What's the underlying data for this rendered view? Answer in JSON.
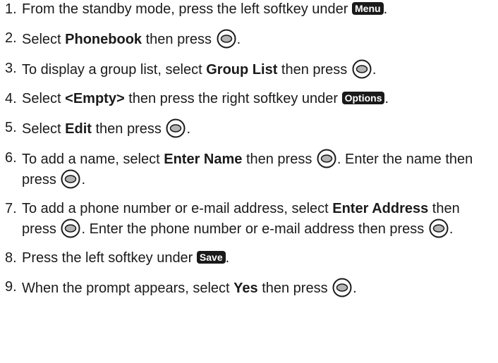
{
  "steps": [
    {
      "num": "1.",
      "parts": [
        {
          "t": "text",
          "v": "From the standby mode, press the left softkey under "
        },
        {
          "t": "key",
          "v": "Menu"
        },
        {
          "t": "text",
          "v": "."
        }
      ]
    },
    {
      "num": "2.",
      "parts": [
        {
          "t": "text",
          "v": "Select "
        },
        {
          "t": "bold",
          "v": "Phonebook"
        },
        {
          "t": "text",
          "v": " then press "
        },
        {
          "t": "icon",
          "v": "ok-button-icon"
        },
        {
          "t": "text",
          "v": "."
        }
      ]
    },
    {
      "num": "3.",
      "parts": [
        {
          "t": "text",
          "v": "To display a group list, select "
        },
        {
          "t": "bold",
          "v": "Group List"
        },
        {
          "t": "text",
          "v": " then press "
        },
        {
          "t": "icon",
          "v": "ok-button-icon"
        },
        {
          "t": "text",
          "v": "."
        }
      ]
    },
    {
      "num": "4.",
      "parts": [
        {
          "t": "text",
          "v": "Select "
        },
        {
          "t": "bold",
          "v": "<Empty>"
        },
        {
          "t": "text",
          "v": " then press the right softkey under "
        },
        {
          "t": "key",
          "v": "Options"
        },
        {
          "t": "text",
          "v": "."
        }
      ]
    },
    {
      "num": "5.",
      "parts": [
        {
          "t": "text",
          "v": "Select "
        },
        {
          "t": "bold",
          "v": "Edit"
        },
        {
          "t": "text",
          "v": " then press "
        },
        {
          "t": "icon",
          "v": "ok-button-icon"
        },
        {
          "t": "text",
          "v": "."
        }
      ]
    },
    {
      "num": "6.",
      "parts": [
        {
          "t": "text",
          "v": "To add a name, select "
        },
        {
          "t": "bold",
          "v": "Enter Name"
        },
        {
          "t": "text",
          "v": " then press "
        },
        {
          "t": "icon",
          "v": "ok-button-icon"
        },
        {
          "t": "text",
          "v": ". Enter the name then press "
        },
        {
          "t": "icon",
          "v": "ok-button-icon"
        },
        {
          "t": "text",
          "v": "."
        }
      ]
    },
    {
      "num": "7.",
      "parts": [
        {
          "t": "text",
          "v": "To add a phone number or e-mail address, select "
        },
        {
          "t": "bold",
          "v": "Enter Address"
        },
        {
          "t": "text",
          "v": " then press "
        },
        {
          "t": "icon",
          "v": "ok-button-icon"
        },
        {
          "t": "text",
          "v": ". Enter the phone number or e-mail address then press "
        },
        {
          "t": "icon",
          "v": "ok-button-icon"
        },
        {
          "t": "text",
          "v": "."
        }
      ]
    },
    {
      "num": "8.",
      "parts": [
        {
          "t": "text",
          "v": "Press the left softkey under "
        },
        {
          "t": "key",
          "v": "Save"
        },
        {
          "t": "text",
          "v": "."
        }
      ]
    },
    {
      "num": "9.",
      "parts": [
        {
          "t": "text",
          "v": "When the prompt appears, select "
        },
        {
          "t": "bold",
          "v": "Yes"
        },
        {
          "t": "text",
          "v": " then press "
        },
        {
          "t": "icon",
          "v": "ok-button-icon"
        },
        {
          "t": "text",
          "v": "."
        }
      ]
    }
  ]
}
